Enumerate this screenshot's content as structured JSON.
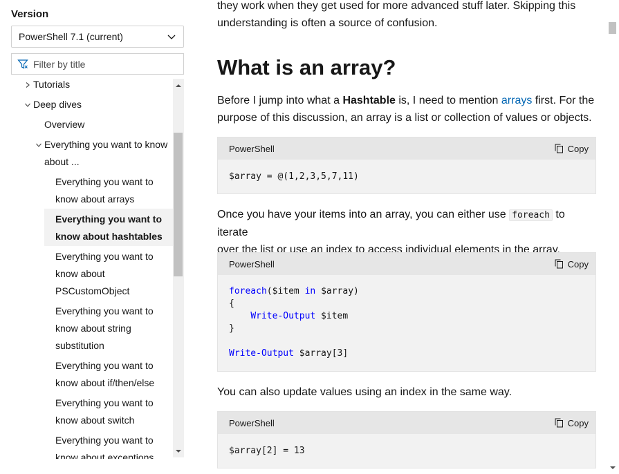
{
  "sidebar": {
    "version_label": "Version",
    "version_value": "PowerShell 7.1 (current)",
    "filter_placeholder": "Filter by title",
    "toc": [
      {
        "label_1": "Tutorials",
        "expanded": false,
        "level": 0
      },
      {
        "label_1": "Deep dives",
        "expanded": true,
        "level": 0
      },
      {
        "label_1": "Overview",
        "level": 1
      },
      {
        "label_1": "Everything you want to know",
        "label_2": "about ...",
        "expanded": true,
        "level": 1
      },
      {
        "label_1": "Everything you want to",
        "label_2": "know about arrays",
        "level": 2
      },
      {
        "label_1": "Everything you want to",
        "label_2": "know about hashtables",
        "level": 2,
        "selected": true
      },
      {
        "label_1": "Everything you want to",
        "label_2": "know about",
        "label_3": "PSCustomObject",
        "level": 2
      },
      {
        "label_1": "Everything you want to",
        "label_2": "know about string",
        "label_3": "substitution",
        "level": 2
      },
      {
        "label_1": "Everything you want to",
        "label_2": "know about if/then/else",
        "level": 2
      },
      {
        "label_1": "Everything you want to",
        "label_2": "know about switch",
        "level": 2
      },
      {
        "label_1": "Everything you want to",
        "label_2": "know about exceptions",
        "level": 2
      }
    ]
  },
  "main": {
    "intro_line_1": "they work when they get used for more advanced stuff later. Skipping this",
    "intro_line_2": "understanding is often a source of confusion.",
    "heading": "What is an array?",
    "p1_a": "Before I jump into what a ",
    "p1_bold": "Hashtable",
    "p1_b": " is, I need to mention ",
    "p1_link": "arrays",
    "p1_c": " first. For the",
    "p1_line2": "purpose of this discussion, an array is a list or collection of values or objects.",
    "p2_a": "Once you have your items into an array, you can either use ",
    "p2_code": "foreach",
    "p2_b": " to iterate",
    "p2_line2": "over the list or use an index to access individual elements in the array.",
    "p3": "You can also update values using an index in the same way.",
    "code_lang": "PowerShell",
    "copy_label": "Copy",
    "code1": "$array = @(1,2,3,5,7,11)",
    "code2_l1_kw": "foreach",
    "code2_l1_a": "($item ",
    "code2_l1_kw2": "in",
    "code2_l1_b": " $array)",
    "code2_l2": "{",
    "code2_l3_kw": "Write-Output",
    "code2_l3_b": " $item",
    "code2_l4": "}",
    "code2_l6_kw": "Write-Output",
    "code2_l6_b": " $array[3]",
    "code3": "$array[2] = 13"
  },
  "colors": {
    "link": "#0065b3",
    "keyword": "#0101fd",
    "code_bg": "#f2f2f2",
    "code_header_bg": "#e6e6e6",
    "selected_bg": "#f2f2f2"
  }
}
